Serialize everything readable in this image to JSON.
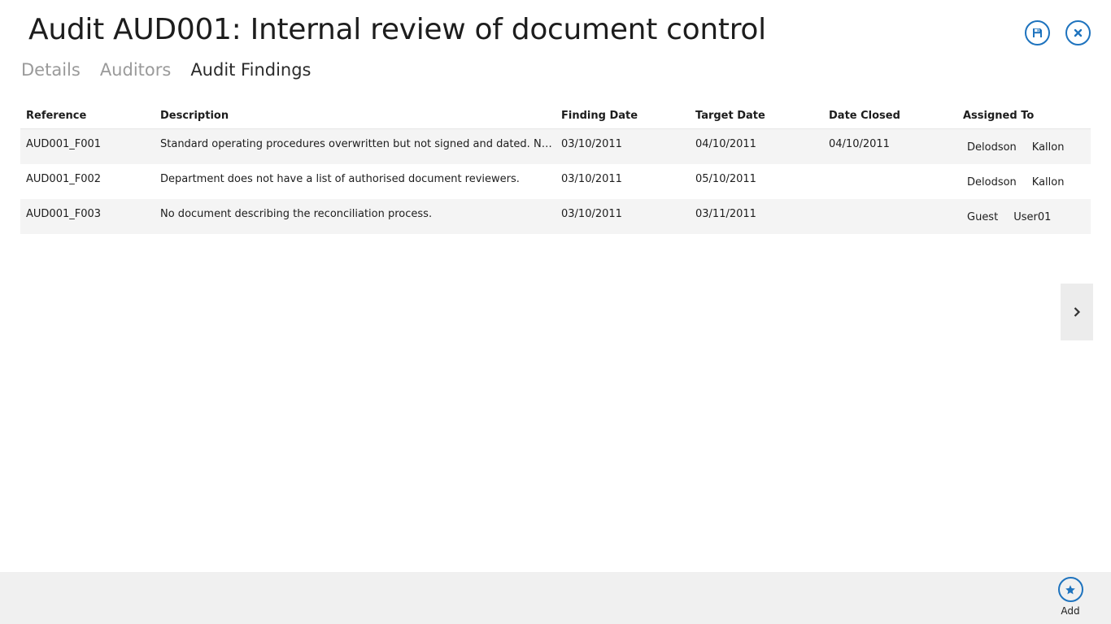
{
  "header": {
    "title": "Audit AUD001: Internal review of document control",
    "actions": [
      {
        "icon": "save-icon"
      },
      {
        "icon": "close-icon"
      }
    ]
  },
  "tabs": [
    {
      "label": "Details",
      "active": false
    },
    {
      "label": "Auditors",
      "active": false
    },
    {
      "label": "Audit Findings",
      "active": true
    }
  ],
  "findings": {
    "columns": [
      "Reference",
      "Description",
      "Finding Date",
      "Target Date",
      "Date Closed",
      "Assigned To"
    ],
    "rows": [
      {
        "reference": "AUD001_F001",
        "description": "Standard operating procedures overwritten but not signed and dated. No re...",
        "finding_date": "03/10/2011",
        "target_date": "04/10/2011",
        "date_closed": "04/10/2011",
        "assigned_first": "Delodson",
        "assigned_last": "Kallon"
      },
      {
        "reference": "AUD001_F002",
        "description": "Department does not have a list of authorised document reviewers.",
        "finding_date": "03/10/2011",
        "target_date": "05/10/2011",
        "date_closed": "",
        "assigned_first": "Delodson",
        "assigned_last": "Kallon"
      },
      {
        "reference": "AUD001_F003",
        "description": "No document describing the reconciliation process.",
        "finding_date": "03/10/2011",
        "target_date": "03/11/2011",
        "date_closed": "",
        "assigned_first": "Guest",
        "assigned_last": "User01"
      }
    ]
  },
  "side_nav": {
    "icon": "chevron-right-icon"
  },
  "appbar": {
    "add_label": "Add",
    "add_icon": "star-icon"
  },
  "colors": {
    "accent": "#1e73be",
    "appbar_bg": "#f0f0f0",
    "row_alt": "#f4f4f4"
  }
}
